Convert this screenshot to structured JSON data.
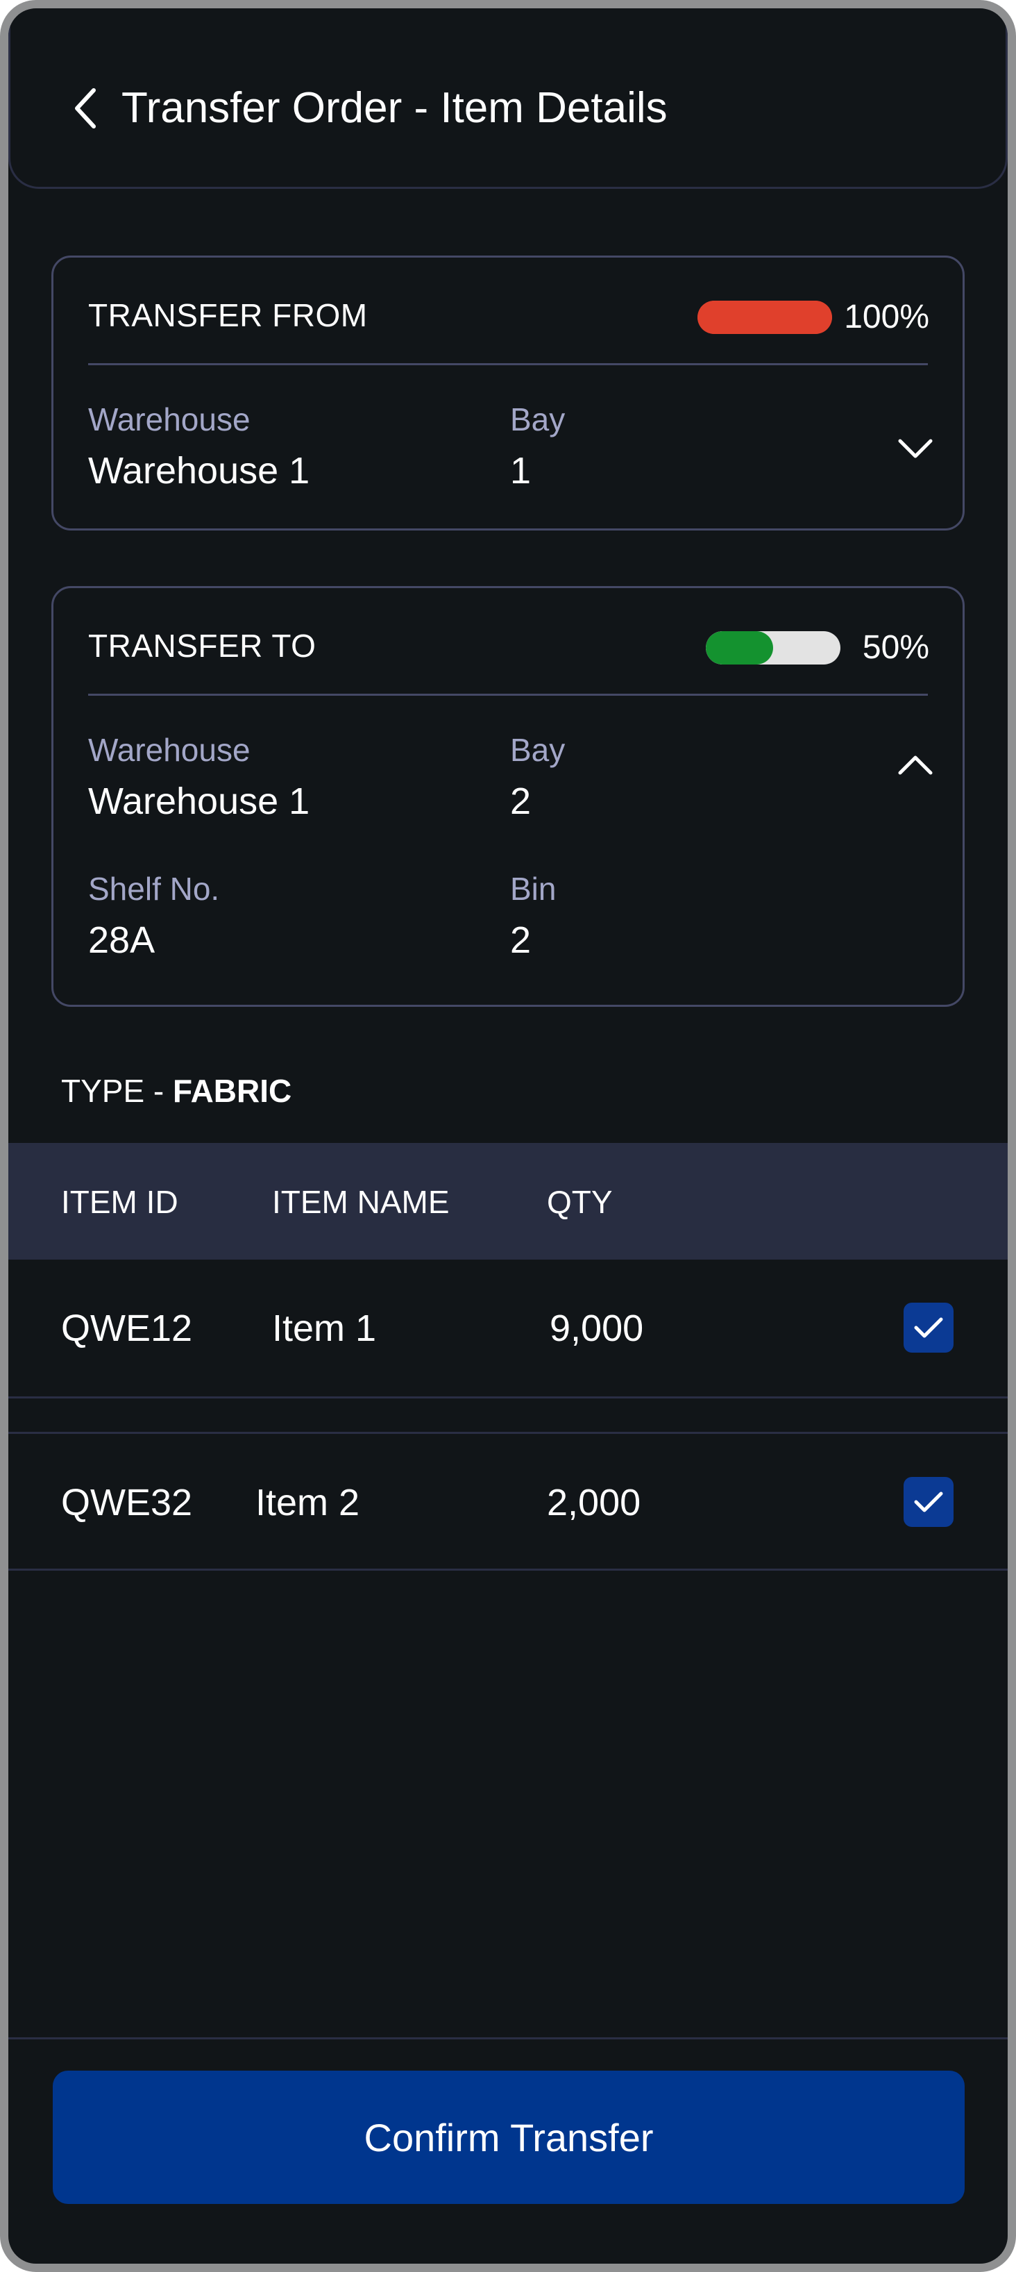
{
  "header": {
    "title": "Transfer Order - Item Details",
    "back_icon": "chevron-left-icon"
  },
  "transfer_from": {
    "title": "TRANSFER FROM",
    "progress_percent": 100,
    "progress_label": "100%",
    "progress_color": "#e0402c",
    "fields": {
      "warehouse_label": "Warehouse",
      "warehouse_value": "Warehouse 1",
      "bay_label": "Bay",
      "bay_value": "1"
    },
    "expanded": false,
    "toggle_icon": "chevron-down-icon"
  },
  "transfer_to": {
    "title": "TRANSFER TO",
    "progress_percent": 50,
    "progress_label": "50%",
    "progress_color": "#14922f",
    "progress_track_color": "#e3e3e3",
    "fields": {
      "warehouse_label": "Warehouse",
      "warehouse_value": "Warehouse 1",
      "bay_label": "Bay",
      "bay_value": "2",
      "shelf_label": "Shelf No.",
      "shelf_value": "28A",
      "bin_label": "Bin",
      "bin_value": "2"
    },
    "expanded": true,
    "toggle_icon": "chevron-up-icon"
  },
  "type": {
    "prefix": "TYPE - ",
    "value": "FABRIC"
  },
  "table": {
    "columns": [
      "ITEM ID",
      "ITEM NAME",
      "QTY"
    ],
    "rows": [
      {
        "id": "QWE12",
        "name": "Item 1",
        "qty": "9,000",
        "checked": true
      },
      {
        "id": "QWE32",
        "name": "Item 2",
        "qty": "2,000",
        "checked": true
      }
    ]
  },
  "actions": {
    "confirm_label": "Confirm Transfer"
  },
  "colors": {
    "background": "#111518",
    "border": "#444865",
    "table_header_bg": "#282d41",
    "primary": "#00368e",
    "checkbox": "#0b3a94",
    "label": "#a3a7c8"
  }
}
